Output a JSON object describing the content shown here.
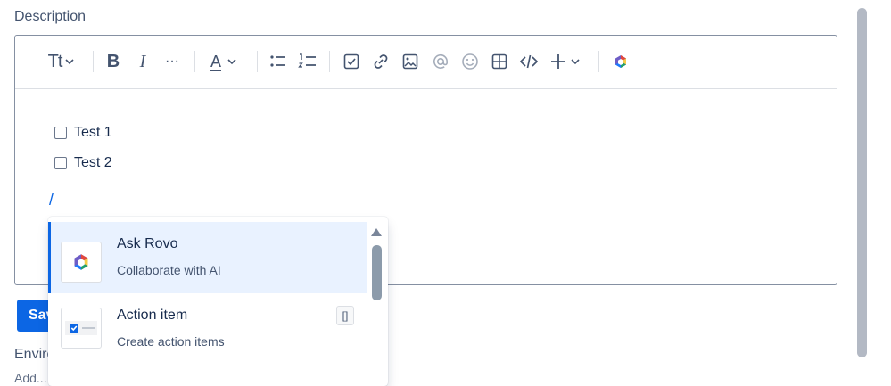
{
  "field": {
    "description_label": "Description"
  },
  "toolbar": {
    "text_style": "Tt",
    "bold": "B",
    "italic": "I",
    "more": "···",
    "text_color": "A",
    "shortcut_bracket": "[]"
  },
  "content": {
    "tasks": [
      {
        "label": "Test 1",
        "checked": false
      },
      {
        "label": "Test 2",
        "checked": false
      }
    ],
    "slash": "/"
  },
  "menu": {
    "items": [
      {
        "title": "Ask Rovo",
        "description": "Collaborate with AI",
        "icon": "rovo-icon",
        "selected": true
      },
      {
        "title": "Action item",
        "description": "Create action items",
        "icon": "action-item-icon",
        "shortcut": "[]"
      }
    ]
  },
  "actions": {
    "save_label": "Save"
  },
  "environment": {
    "label": "Environment",
    "placeholder": "Add..."
  },
  "colors": {
    "accent": "#0c66e4",
    "border": "#8590a2",
    "selected_bg": "#e9f2ff"
  }
}
